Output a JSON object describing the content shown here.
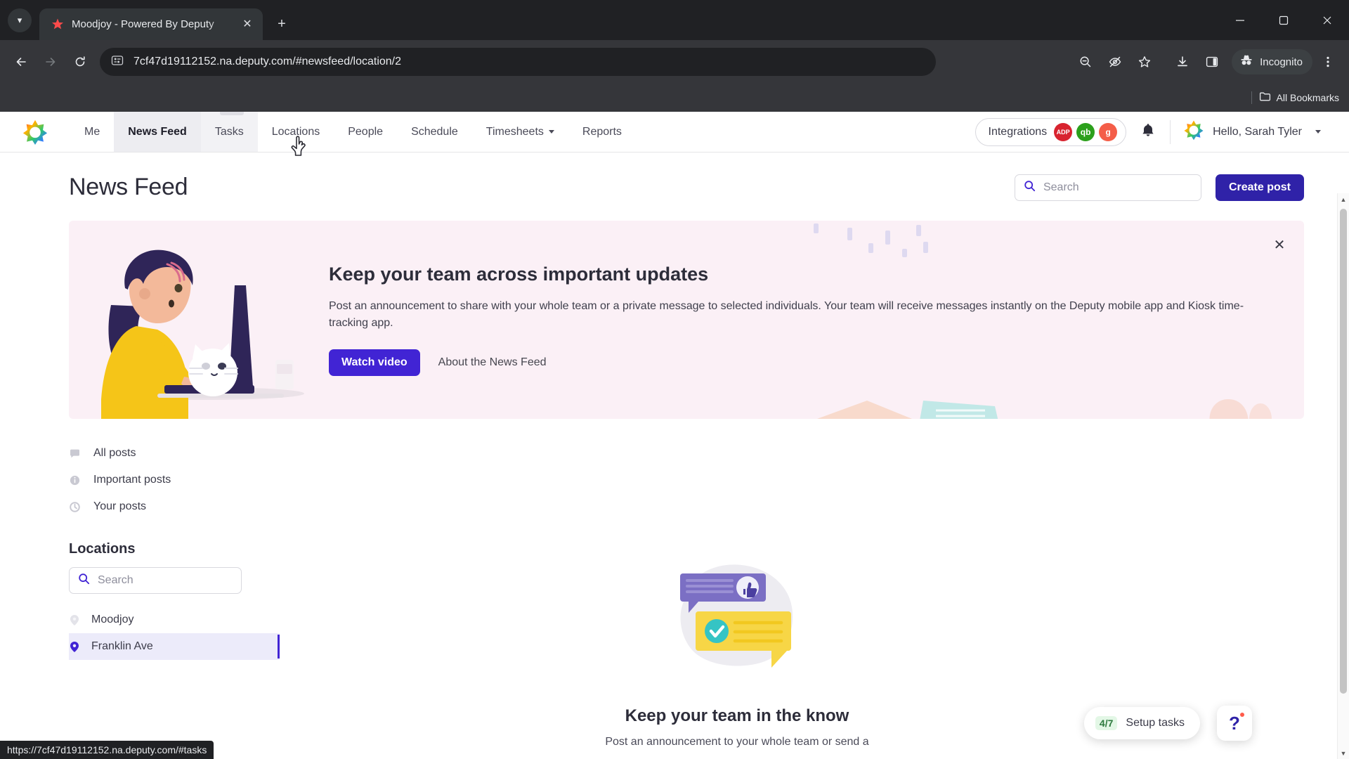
{
  "browser": {
    "tab": {
      "title": "Moodjoy - Powered By Deputy",
      "favicon_icon": "deputy-star-icon",
      "close_icon": "close-icon"
    },
    "tab_search_icon": "chevron-down-icon",
    "new_tab_icon": "plus-icon",
    "window_controls": {
      "minimize": "minimize-icon",
      "maximize": "maximize-icon",
      "close": "close-icon"
    },
    "nav": {
      "back_icon": "back-arrow-icon",
      "forward_icon": "forward-arrow-icon",
      "reload_icon": "reload-icon"
    },
    "omnibox": {
      "site_info_icon": "site-settings-icon",
      "url": "7cf47d19112152.na.deputy.com/#newsfeed/location/2"
    },
    "toolbar_right": {
      "zoom_icon": "zoom-out-icon",
      "tracking_icon": "eye-off-icon",
      "bookmark_icon": "star-icon",
      "download_icon": "download-icon",
      "sidepanel_icon": "side-panel-icon",
      "incognito_label": "Incognito",
      "incognito_icon": "incognito-hat-icon",
      "menu_icon": "three-dot-menu-icon"
    },
    "bookmarks_bar": {
      "folder_icon": "folder-icon",
      "label": "All Bookmarks"
    },
    "status_bar": {
      "url": "https://7cf47d19112152.na.deputy.com/#tasks"
    }
  },
  "app": {
    "brand_icon": "deputy-logo-icon",
    "nav_items": [
      {
        "label": "Me",
        "state": "default"
      },
      {
        "label": "News Feed",
        "state": "active"
      },
      {
        "label": "Tasks",
        "state": "hovered"
      },
      {
        "label": "Locations",
        "state": "default"
      },
      {
        "label": "People",
        "state": "default"
      },
      {
        "label": "Schedule",
        "state": "default"
      },
      {
        "label": "Timesheets",
        "state": "dropdown"
      },
      {
        "label": "Reports",
        "state": "default"
      }
    ],
    "integrations": {
      "label": "Integrations",
      "badges": [
        {
          "name": "ADP",
          "text": "ADP",
          "color": "#d8232f"
        },
        {
          "name": "QuickBooks",
          "text": "qb",
          "color": "#2ca01c"
        },
        {
          "name": "Gusto",
          "text": "g",
          "color": "#f45d48"
        }
      ]
    },
    "notifications_icon": "bell-icon",
    "user": {
      "avatar_icon": "user-avatar-icon",
      "greeting": "Hello, Sarah Tyler",
      "caret_icon": "chevron-down-icon"
    }
  },
  "page": {
    "title": "News Feed",
    "search": {
      "icon": "search-icon",
      "placeholder": "Search",
      "value": ""
    },
    "create_post_label": "Create post"
  },
  "banner": {
    "illustration": "woman-at-laptop-with-cat-illustration",
    "title": "Keep your team across important updates",
    "body": "Post an announcement to share with your whole team or a private message to selected individuals. Your team will receive messages instantly on the Deputy mobile app and Kiosk time-tracking app.",
    "watch_video_label": "Watch video",
    "about_link_label": "About the News Feed",
    "close_icon": "close-icon",
    "accent_color": "#4124d4",
    "background_color": "#fbf0f6"
  },
  "filters": [
    {
      "label": "All posts",
      "icon": "message-icon"
    },
    {
      "label": "Important posts",
      "icon": "info-icon"
    },
    {
      "label": "Your posts",
      "icon": "refresh-icon"
    }
  ],
  "locations": {
    "heading": "Locations",
    "search": {
      "icon": "search-icon",
      "placeholder": "Search",
      "value": ""
    },
    "items": [
      {
        "label": "Moodjoy",
        "icon": "location-pin-icon",
        "selected": false
      },
      {
        "label": "Franklin Ave",
        "icon": "location-pin-icon",
        "selected": true
      }
    ],
    "selected_color": "#4124d4"
  },
  "empty_state": {
    "illustration": "chat-bubbles-illustration",
    "title": "Keep your team in the know",
    "subtitle": "Post an announcement to your whole team or send a"
  },
  "widgets": {
    "setup_tasks": {
      "fraction": "4/7",
      "label": "Setup tasks"
    },
    "help": {
      "icon": "question-mark-icon",
      "has_badge": true
    }
  }
}
